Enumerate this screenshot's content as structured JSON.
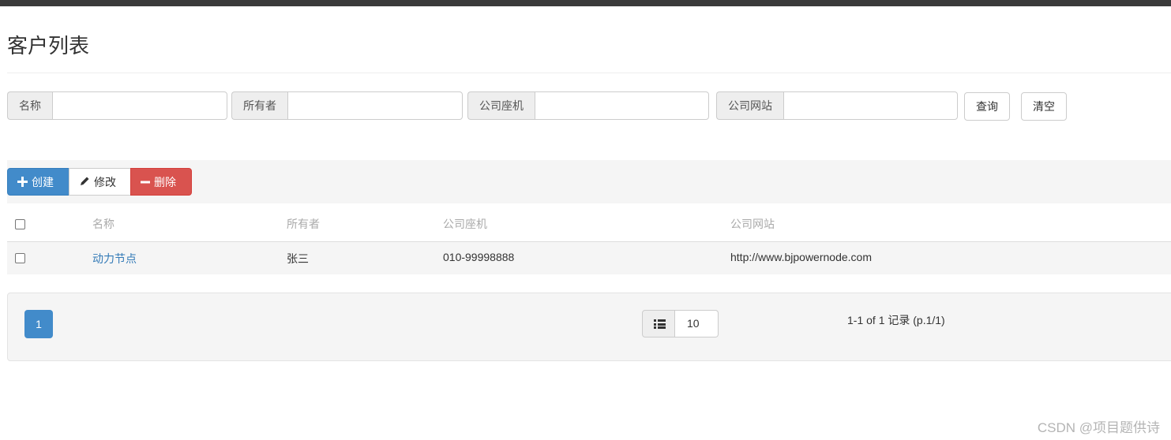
{
  "page": {
    "title": "客户列表"
  },
  "search": {
    "fields": [
      {
        "label": "名称",
        "value": ""
      },
      {
        "label": "所有者",
        "value": ""
      },
      {
        "label": "公司座机",
        "value": ""
      },
      {
        "label": "公司网站",
        "value": ""
      }
    ],
    "query_label": "查询",
    "clear_label": "清空"
  },
  "toolbar": {
    "create_label": "创建",
    "edit_label": "修改",
    "delete_label": "删除",
    "create_icon": "plus-icon",
    "edit_icon": "pencil-icon",
    "delete_icon": "minus-icon"
  },
  "table": {
    "columns": [
      "名称",
      "所有者",
      "公司座机",
      "公司网站"
    ],
    "rows": [
      {
        "name": "动力节点",
        "owner": "张三",
        "phone": "010-99998888",
        "website": "http://www.bjpowernode.com",
        "checked": false
      }
    ]
  },
  "pagination": {
    "current_page": "1",
    "page_size": "10",
    "info": "1-1 of 1 记录 (p.1/1)",
    "page_size_icon": "list-icon"
  },
  "watermark": "CSDN @项目题供诗",
  "colors": {
    "primary": "#428bca",
    "danger": "#d9534f",
    "link": "#337ab7",
    "topbar": "#3a3a3a"
  }
}
